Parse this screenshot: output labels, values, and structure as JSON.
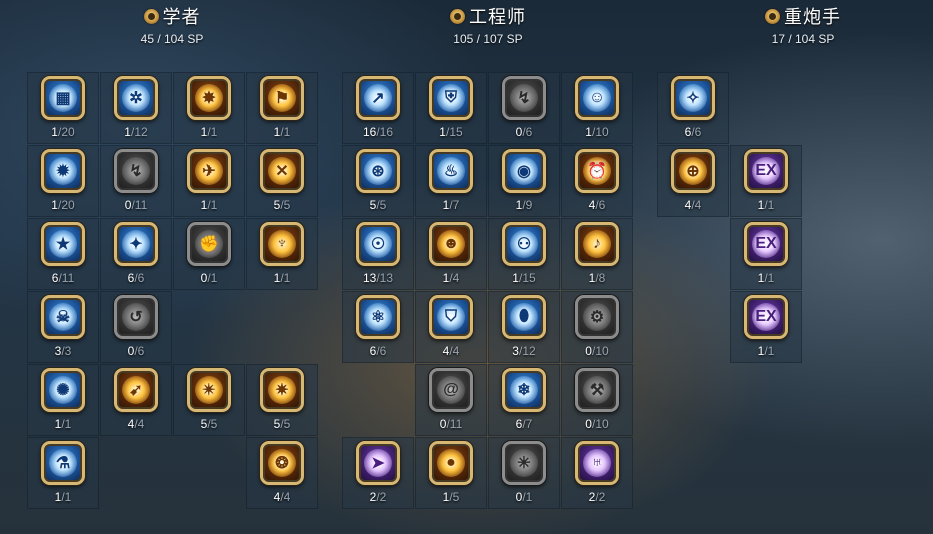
{
  "classes": [
    {
      "name": "学者",
      "sp": "45 / 104 SP",
      "icon": "gear-emblem-icon",
      "columns": [
        [
          {
            "glyph": "block-icon",
            "color": "blue",
            "level": "1",
            "max": "20"
          },
          {
            "glyph": "flame-orb-icon",
            "color": "blue",
            "level": "1",
            "max": "20"
          },
          {
            "glyph": "star-shield-icon",
            "color": "blue",
            "level": "6",
            "max": "11"
          },
          {
            "glyph": "skull-icon",
            "color": "blue",
            "level": "3",
            "max": "3"
          },
          {
            "glyph": "brain-burst-icon",
            "color": "blue",
            "level": "1",
            "max": "1"
          },
          {
            "glyph": "potion-icon",
            "color": "blue",
            "level": "1",
            "max": "1"
          }
        ],
        [
          {
            "glyph": "swirl-gear-icon",
            "color": "blue",
            "level": "1",
            "max": "12"
          },
          {
            "glyph": "runner-icon",
            "color": "locked",
            "level": "0",
            "max": "11"
          },
          {
            "glyph": "sparkle-icon",
            "color": "blue",
            "level": "6",
            "max": "6"
          },
          {
            "glyph": "spin-kick-icon",
            "color": "locked",
            "level": "0",
            "max": "6"
          },
          {
            "glyph": "dash-icon",
            "color": "gold",
            "level": "4",
            "max": "4"
          },
          null
        ],
        [
          {
            "glyph": "burst-icon",
            "color": "gold",
            "level": "1",
            "max": "1"
          },
          {
            "glyph": "air-kick-icon",
            "color": "gold",
            "level": "1",
            "max": "1"
          },
          {
            "glyph": "fist-icon",
            "color": "locked",
            "level": "0",
            "max": "1"
          },
          null,
          {
            "glyph": "hp-blast-icon",
            "color": "gold",
            "level": "5",
            "max": "5"
          },
          null
        ],
        [
          {
            "glyph": "boot-icon",
            "color": "gold",
            "level": "1",
            "max": "1"
          },
          {
            "glyph": "crossed-blades-icon",
            "color": "gold",
            "level": "5",
            "max": "5"
          },
          {
            "glyph": "power-figure-icon",
            "color": "gold",
            "level": "1",
            "max": "1"
          },
          null,
          {
            "glyph": "sp-blast-icon",
            "color": "gold",
            "level": "5",
            "max": "5"
          },
          {
            "glyph": "spirit-blast-icon",
            "color": "gold",
            "level": "4",
            "max": "4"
          }
        ]
      ]
    },
    {
      "name": "工程师",
      "sp": "105 / 107 SP",
      "icon": "gear-emblem-icon",
      "columns": [
        [
          {
            "glyph": "arc-strike-icon",
            "color": "blue",
            "level": "16",
            "max": "16"
          },
          {
            "glyph": "cannon-icon",
            "color": "blue",
            "level": "5",
            "max": "5"
          },
          {
            "glyph": "mech-face-icon",
            "color": "blue",
            "level": "13",
            "max": "13"
          },
          {
            "glyph": "drone-icon",
            "color": "blue",
            "level": "6",
            "max": "6"
          },
          null,
          {
            "glyph": "rocket-icon",
            "color": "purple",
            "level": "2",
            "max": "2"
          }
        ],
        [
          {
            "glyph": "turret-icon",
            "color": "blue",
            "level": "1",
            "max": "15"
          },
          {
            "glyph": "flame-shield-icon",
            "color": "blue",
            "level": "1",
            "max": "7"
          },
          {
            "glyph": "bot-icon",
            "color": "gold",
            "level": "1",
            "max": "4"
          },
          {
            "glyph": "guard-shield-icon",
            "color": "blue",
            "level": "4",
            "max": "4"
          },
          {
            "glyph": "swirl-icon",
            "color": "locked",
            "level": "0",
            "max": "11"
          },
          {
            "glyph": "bomb-icon",
            "color": "gold",
            "level": "1",
            "max": "5"
          }
        ],
        [
          {
            "glyph": "runner-flame-icon",
            "color": "locked",
            "level": "0",
            "max": "6"
          },
          {
            "glyph": "orb-icon",
            "color": "blue",
            "level": "1",
            "max": "9"
          },
          {
            "glyph": "twin-bot-icon",
            "color": "blue",
            "level": "1",
            "max": "15"
          },
          {
            "glyph": "egg-icon",
            "color": "blue",
            "level": "3",
            "max": "12"
          },
          {
            "glyph": "snowflake-icon",
            "color": "blue",
            "level": "6",
            "max": "7"
          },
          {
            "glyph": "web-icon",
            "color": "locked",
            "level": "0",
            "max": "1"
          }
        ],
        [
          {
            "glyph": "ghost-icon",
            "color": "blue",
            "level": "1",
            "max": "10"
          },
          {
            "glyph": "alarm-icon",
            "color": "gold",
            "level": "4",
            "max": "6"
          },
          {
            "glyph": "bell-icon",
            "color": "gold",
            "level": "1",
            "max": "8"
          },
          {
            "glyph": "gear-bot-icon",
            "color": "locked",
            "level": "0",
            "max": "10"
          },
          {
            "glyph": "wrench-icon",
            "color": "locked",
            "level": "0",
            "max": "10"
          },
          {
            "glyph": "monster-icon",
            "color": "purple",
            "level": "2",
            "max": "2"
          }
        ]
      ]
    },
    {
      "name": "重炮手",
      "sp": "17 / 104 SP",
      "icon": "gear-emblem-icon",
      "columns": [
        [
          {
            "glyph": "fan-blade-icon",
            "color": "blue",
            "level": "6",
            "max": "6"
          },
          {
            "glyph": "gatling-icon",
            "color": "gold",
            "level": "4",
            "max": "4"
          },
          null,
          null,
          null,
          null
        ],
        [
          null,
          {
            "glyph": "ex-sparkle-icon",
            "color": "purple",
            "level": "1",
            "max": "1"
          },
          {
            "glyph": "ex-crown-icon",
            "color": "purple",
            "level": "1",
            "max": "1"
          },
          {
            "glyph": "ex-mushroom-icon",
            "color": "purple",
            "level": "1",
            "max": "1"
          },
          null,
          null
        ]
      ]
    }
  ]
}
